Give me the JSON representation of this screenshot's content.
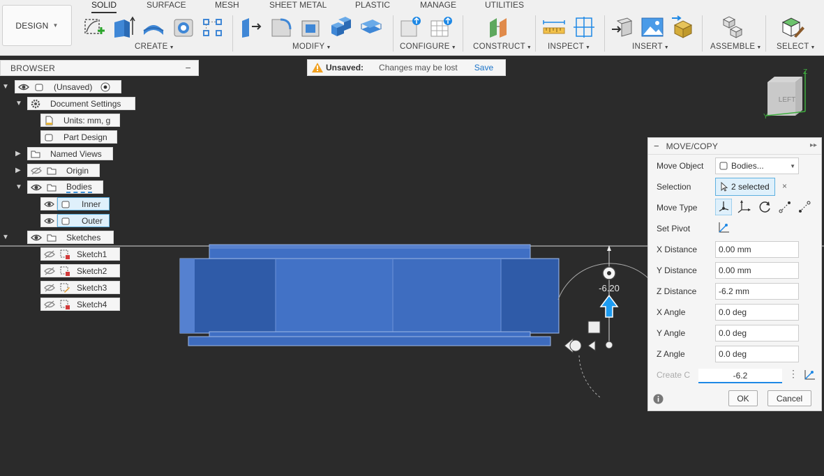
{
  "workspace": {
    "label": "DESIGN"
  },
  "tabs": [
    "SOLID",
    "SURFACE",
    "MESH",
    "SHEET METAL",
    "PLASTIC",
    "MANAGE",
    "UTILITIES"
  ],
  "groups": {
    "create": "CREATE",
    "modify": "MODIFY",
    "configure": "CONFIGURE",
    "construct": "CONSTRUCT",
    "inspect": "INSPECT",
    "insert": "INSERT",
    "assemble": "ASSEMBLE",
    "select": "SELECT"
  },
  "browser": {
    "title": "BROWSER",
    "root": "(Unsaved)",
    "document_settings": "Document Settings",
    "units": "Units: mm, g",
    "part_design": "Part Design",
    "named_views": "Named Views",
    "origin": "Origin",
    "bodies": "Bodies",
    "inner": "Inner",
    "outer": "Outer",
    "sketches": "Sketches",
    "sketch_items": [
      "Sketch1",
      "Sketch2",
      "Sketch3",
      "Sketch4"
    ]
  },
  "banner": {
    "status": "Unsaved:",
    "message": "Changes may be lost",
    "action": "Save"
  },
  "viewport": {
    "gizmo_value": "-6.20",
    "viewcube_face": "LEFT",
    "axis_label": "Z",
    "axis_y": "Y",
    "body_color": "#3d6ec2"
  },
  "dialog": {
    "title": "MOVE/COPY",
    "move_object_label": "Move Object",
    "move_object_value": "Bodies...",
    "selection_label": "Selection",
    "selection_value": "2 selected",
    "move_type_label": "Move Type",
    "set_pivot_label": "Set Pivot",
    "x_distance_label": "X Distance",
    "x_distance": "0.00 mm",
    "y_distance_label": "Y Distance",
    "y_distance": "0.00 mm",
    "z_distance_label": "Z Distance",
    "z_distance": "-6.2 mm",
    "x_angle_label": "X Angle",
    "x_angle": "0.0 deg",
    "y_angle_label": "Y Angle",
    "y_angle": "0.0 deg",
    "z_angle_label": "Z Angle",
    "z_angle": "0.0 deg",
    "create_copy_label": "Create C",
    "inline_value": "-6.2",
    "ok": "OK",
    "cancel": "Cancel"
  }
}
